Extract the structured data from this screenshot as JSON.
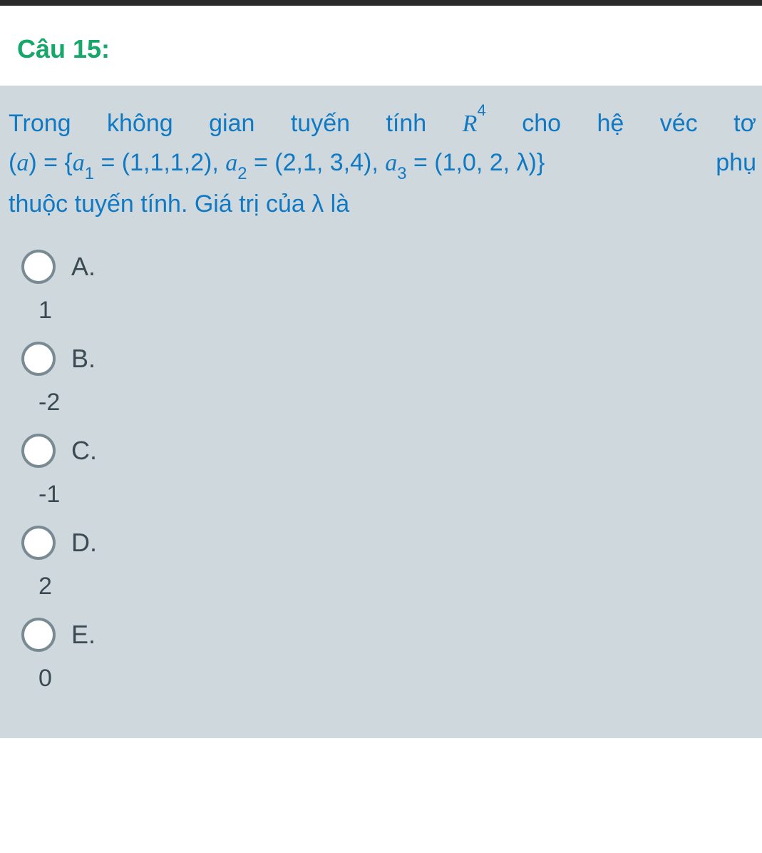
{
  "header": {
    "question_number": "Câu 15:"
  },
  "prompt": {
    "line1_words": [
      "Trong",
      "không",
      "gian",
      "tuyến",
      "tính",
      "R4_MARK",
      "cho",
      "hệ",
      "véc",
      "tơ"
    ],
    "line2_prefix": "(",
    "line2_a": "a",
    "line2_mid1": ") = {",
    "line2_a1": "a",
    "line2_sub1": "1",
    "line2_eq1": " = (1,1,1,2), ",
    "line2_a2": "a",
    "line2_sub2": "2",
    "line2_eq2": " = (2,1, 3,4), ",
    "line2_a3": "a",
    "line2_sub3": "3",
    "line2_eq3": " = (1,0, 2, λ)}",
    "line2_suffix": "phụ",
    "line3": "thuộc tuyến tính. Giá trị của λ là",
    "R_letter": "R",
    "R_exp": "4"
  },
  "options": [
    {
      "label": "A.",
      "value": "1"
    },
    {
      "label": "B.",
      "value": "-2"
    },
    {
      "label": "C.",
      "value": "-1"
    },
    {
      "label": "D.",
      "value": "2"
    },
    {
      "label": "E.",
      "value": "0"
    }
  ]
}
